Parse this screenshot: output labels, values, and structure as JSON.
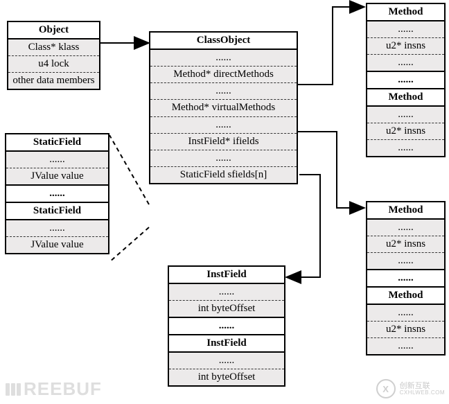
{
  "object_box": {
    "title": "Object",
    "rows": [
      "Class* klass",
      "u4 lock",
      "other data members"
    ]
  },
  "classobject_box": {
    "title": "ClassObject",
    "rows": [
      "......",
      "Method* directMethods",
      "......",
      "Method* virtualMethods",
      "......",
      "InstField* ifields",
      "......",
      "StaticField sfields[n]"
    ]
  },
  "staticfield_box": {
    "blocks": [
      {
        "title": "StaticField",
        "rows": [
          "......",
          "JValue value"
        ]
      },
      {
        "title_row": "......"
      },
      {
        "title": "StaticField",
        "rows": [
          "......",
          "JValue value"
        ]
      }
    ]
  },
  "instfield_box": {
    "blocks": [
      {
        "title": "InstField",
        "rows": [
          "......",
          "int byteOffset"
        ]
      },
      {
        "title_row": "......"
      },
      {
        "title": "InstField",
        "rows": [
          "......",
          "int byteOffset"
        ]
      }
    ]
  },
  "method_box_top": {
    "blocks": [
      {
        "title": "Method",
        "rows": [
          "......",
          "u2* insns",
          "......"
        ]
      },
      {
        "title_row": "......"
      },
      {
        "title": "Method",
        "rows": [
          "......",
          "u2* insns",
          "......"
        ]
      }
    ]
  },
  "method_box_bottom": {
    "blocks": [
      {
        "title": "Method",
        "rows": [
          "......",
          "u2* insns",
          "......"
        ]
      },
      {
        "title_row": "......"
      },
      {
        "title": "Method",
        "rows": [
          "......",
          "u2* insns",
          "......"
        ]
      }
    ]
  },
  "watermark_left": "REEBUF",
  "watermark_right": {
    "badge": "X",
    "line1": "创新互联",
    "line2": "CXHLWEB.COM"
  }
}
